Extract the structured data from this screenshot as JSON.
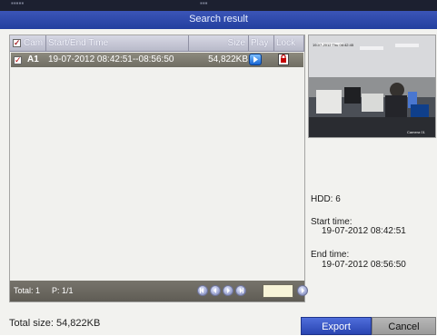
{
  "window": {
    "title": "Search result"
  },
  "table": {
    "headers": {
      "cam": "Cam",
      "time": "Start/End Time",
      "size": "Size",
      "play": "Play",
      "lock": "Lock"
    },
    "rows": [
      {
        "cam": "A1",
        "time": "19-07-2012 08:42:51--08:56:50",
        "size": "54,822KB"
      }
    ]
  },
  "pagination": {
    "total": "Total: 1",
    "page": "P: 1/1",
    "page_input": ""
  },
  "preview": {
    "timestamp": "19-07-2012 Thu 08:42:45",
    "camera_label": "Camera 01"
  },
  "details": {
    "hdd": "HDD: 6",
    "start_label": "Start time:",
    "start_value": "19-07-2012 08:42:51",
    "end_label": "End time:",
    "end_value": "19-07-2012 08:56:50"
  },
  "footer": {
    "total_size": "Total size: 54,822KB",
    "export": "Export",
    "cancel": "Cancel"
  },
  "colors": {
    "title_blue": "#2f49aa",
    "row_bg": "#7f7b71",
    "export_blue": "#3653c4"
  }
}
